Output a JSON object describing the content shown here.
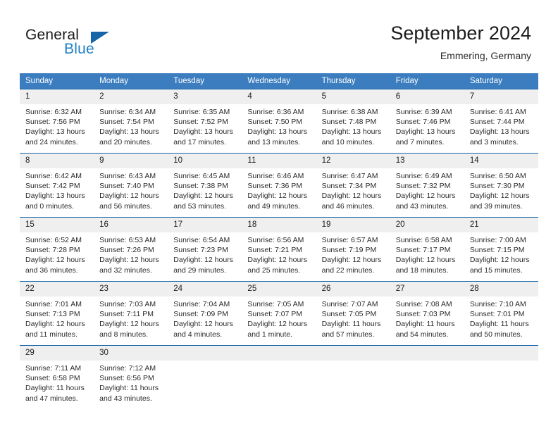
{
  "brand": {
    "name_part1": "General",
    "name_part2": "Blue",
    "logo_icon": "triangle-icon"
  },
  "header": {
    "title": "September 2024",
    "subtitle": "Emmering, Germany"
  },
  "colors": {
    "header_blue": "#3b7dbf",
    "border_blue": "#1565a8",
    "daynum_bg": "#efefef",
    "brand_blue": "#1f7fc4",
    "text": "#2b2b2b"
  },
  "calendar": {
    "weekday_headers": [
      "Sunday",
      "Monday",
      "Tuesday",
      "Wednesday",
      "Thursday",
      "Friday",
      "Saturday"
    ],
    "weeks": [
      [
        {
          "day": "1",
          "sunrise": "Sunrise: 6:32 AM",
          "sunset": "Sunset: 7:56 PM",
          "daylight1": "Daylight: 13 hours",
          "daylight2": "and 24 minutes."
        },
        {
          "day": "2",
          "sunrise": "Sunrise: 6:34 AM",
          "sunset": "Sunset: 7:54 PM",
          "daylight1": "Daylight: 13 hours",
          "daylight2": "and 20 minutes."
        },
        {
          "day": "3",
          "sunrise": "Sunrise: 6:35 AM",
          "sunset": "Sunset: 7:52 PM",
          "daylight1": "Daylight: 13 hours",
          "daylight2": "and 17 minutes."
        },
        {
          "day": "4",
          "sunrise": "Sunrise: 6:36 AM",
          "sunset": "Sunset: 7:50 PM",
          "daylight1": "Daylight: 13 hours",
          "daylight2": "and 13 minutes."
        },
        {
          "day": "5",
          "sunrise": "Sunrise: 6:38 AM",
          "sunset": "Sunset: 7:48 PM",
          "daylight1": "Daylight: 13 hours",
          "daylight2": "and 10 minutes."
        },
        {
          "day": "6",
          "sunrise": "Sunrise: 6:39 AM",
          "sunset": "Sunset: 7:46 PM",
          "daylight1": "Daylight: 13 hours",
          "daylight2": "and 7 minutes."
        },
        {
          "day": "7",
          "sunrise": "Sunrise: 6:41 AM",
          "sunset": "Sunset: 7:44 PM",
          "daylight1": "Daylight: 13 hours",
          "daylight2": "and 3 minutes."
        }
      ],
      [
        {
          "day": "8",
          "sunrise": "Sunrise: 6:42 AM",
          "sunset": "Sunset: 7:42 PM",
          "daylight1": "Daylight: 13 hours",
          "daylight2": "and 0 minutes."
        },
        {
          "day": "9",
          "sunrise": "Sunrise: 6:43 AM",
          "sunset": "Sunset: 7:40 PM",
          "daylight1": "Daylight: 12 hours",
          "daylight2": "and 56 minutes."
        },
        {
          "day": "10",
          "sunrise": "Sunrise: 6:45 AM",
          "sunset": "Sunset: 7:38 PM",
          "daylight1": "Daylight: 12 hours",
          "daylight2": "and 53 minutes."
        },
        {
          "day": "11",
          "sunrise": "Sunrise: 6:46 AM",
          "sunset": "Sunset: 7:36 PM",
          "daylight1": "Daylight: 12 hours",
          "daylight2": "and 49 minutes."
        },
        {
          "day": "12",
          "sunrise": "Sunrise: 6:47 AM",
          "sunset": "Sunset: 7:34 PM",
          "daylight1": "Daylight: 12 hours",
          "daylight2": "and 46 minutes."
        },
        {
          "day": "13",
          "sunrise": "Sunrise: 6:49 AM",
          "sunset": "Sunset: 7:32 PM",
          "daylight1": "Daylight: 12 hours",
          "daylight2": "and 43 minutes."
        },
        {
          "day": "14",
          "sunrise": "Sunrise: 6:50 AM",
          "sunset": "Sunset: 7:30 PM",
          "daylight1": "Daylight: 12 hours",
          "daylight2": "and 39 minutes."
        }
      ],
      [
        {
          "day": "15",
          "sunrise": "Sunrise: 6:52 AM",
          "sunset": "Sunset: 7:28 PM",
          "daylight1": "Daylight: 12 hours",
          "daylight2": "and 36 minutes."
        },
        {
          "day": "16",
          "sunrise": "Sunrise: 6:53 AM",
          "sunset": "Sunset: 7:26 PM",
          "daylight1": "Daylight: 12 hours",
          "daylight2": "and 32 minutes."
        },
        {
          "day": "17",
          "sunrise": "Sunrise: 6:54 AM",
          "sunset": "Sunset: 7:23 PM",
          "daylight1": "Daylight: 12 hours",
          "daylight2": "and 29 minutes."
        },
        {
          "day": "18",
          "sunrise": "Sunrise: 6:56 AM",
          "sunset": "Sunset: 7:21 PM",
          "daylight1": "Daylight: 12 hours",
          "daylight2": "and 25 minutes."
        },
        {
          "day": "19",
          "sunrise": "Sunrise: 6:57 AM",
          "sunset": "Sunset: 7:19 PM",
          "daylight1": "Daylight: 12 hours",
          "daylight2": "and 22 minutes."
        },
        {
          "day": "20",
          "sunrise": "Sunrise: 6:58 AM",
          "sunset": "Sunset: 7:17 PM",
          "daylight1": "Daylight: 12 hours",
          "daylight2": "and 18 minutes."
        },
        {
          "day": "21",
          "sunrise": "Sunrise: 7:00 AM",
          "sunset": "Sunset: 7:15 PM",
          "daylight1": "Daylight: 12 hours",
          "daylight2": "and 15 minutes."
        }
      ],
      [
        {
          "day": "22",
          "sunrise": "Sunrise: 7:01 AM",
          "sunset": "Sunset: 7:13 PM",
          "daylight1": "Daylight: 12 hours",
          "daylight2": "and 11 minutes."
        },
        {
          "day": "23",
          "sunrise": "Sunrise: 7:03 AM",
          "sunset": "Sunset: 7:11 PM",
          "daylight1": "Daylight: 12 hours",
          "daylight2": "and 8 minutes."
        },
        {
          "day": "24",
          "sunrise": "Sunrise: 7:04 AM",
          "sunset": "Sunset: 7:09 PM",
          "daylight1": "Daylight: 12 hours",
          "daylight2": "and 4 minutes."
        },
        {
          "day": "25",
          "sunrise": "Sunrise: 7:05 AM",
          "sunset": "Sunset: 7:07 PM",
          "daylight1": "Daylight: 12 hours",
          "daylight2": "and 1 minute."
        },
        {
          "day": "26",
          "sunrise": "Sunrise: 7:07 AM",
          "sunset": "Sunset: 7:05 PM",
          "daylight1": "Daylight: 11 hours",
          "daylight2": "and 57 minutes."
        },
        {
          "day": "27",
          "sunrise": "Sunrise: 7:08 AM",
          "sunset": "Sunset: 7:03 PM",
          "daylight1": "Daylight: 11 hours",
          "daylight2": "and 54 minutes."
        },
        {
          "day": "28",
          "sunrise": "Sunrise: 7:10 AM",
          "sunset": "Sunset: 7:01 PM",
          "daylight1": "Daylight: 11 hours",
          "daylight2": "and 50 minutes."
        }
      ],
      [
        {
          "day": "29",
          "sunrise": "Sunrise: 7:11 AM",
          "sunset": "Sunset: 6:58 PM",
          "daylight1": "Daylight: 11 hours",
          "daylight2": "and 47 minutes."
        },
        {
          "day": "30",
          "sunrise": "Sunrise: 7:12 AM",
          "sunset": "Sunset: 6:56 PM",
          "daylight1": "Daylight: 11 hours",
          "daylight2": "and 43 minutes."
        },
        {
          "day": "",
          "sunrise": "",
          "sunset": "",
          "daylight1": "",
          "daylight2": ""
        },
        {
          "day": "",
          "sunrise": "",
          "sunset": "",
          "daylight1": "",
          "daylight2": ""
        },
        {
          "day": "",
          "sunrise": "",
          "sunset": "",
          "daylight1": "",
          "daylight2": ""
        },
        {
          "day": "",
          "sunrise": "",
          "sunset": "",
          "daylight1": "",
          "daylight2": ""
        },
        {
          "day": "",
          "sunrise": "",
          "sunset": "",
          "daylight1": "",
          "daylight2": ""
        }
      ]
    ]
  }
}
